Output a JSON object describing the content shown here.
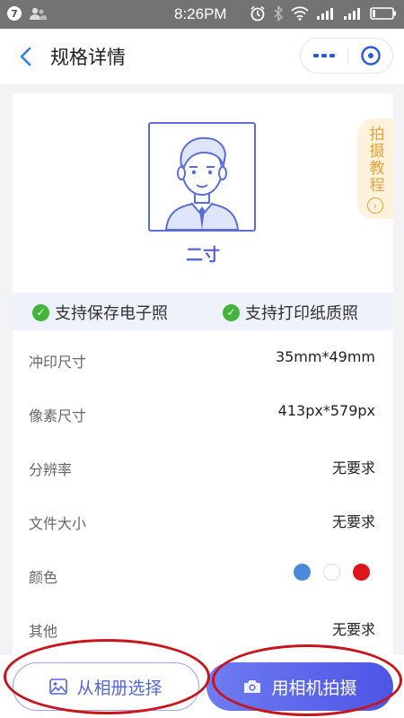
{
  "status_bar": {
    "notif_count": "7",
    "time": "8:26PM"
  },
  "header": {
    "title": "规格详情"
  },
  "spec": {
    "name": "二寸",
    "tutorial": "拍摄教程",
    "support": [
      "支持保存电子照",
      "支持打印纸质照"
    ],
    "rows": [
      {
        "label": "冲印尺寸",
        "value": "35mm*49mm"
      },
      {
        "label": "像素尺寸",
        "value": "413px*579px"
      },
      {
        "label": "分辨率",
        "value": "无要求"
      },
      {
        "label": "文件大小",
        "value": "无要求"
      },
      {
        "label": "颜色",
        "colors": [
          "#4a8ad8",
          "#ffffff",
          "#e0141c"
        ]
      },
      {
        "label": "其他",
        "value": "无要求"
      }
    ]
  },
  "actions": {
    "album": "从相册选择",
    "camera": "用相机拍摄"
  },
  "colors": {
    "accent": "#5566d6",
    "highlight": "#c8141b"
  }
}
